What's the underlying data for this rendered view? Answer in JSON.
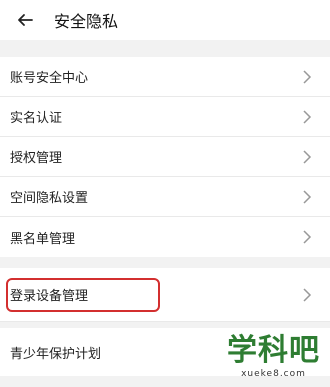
{
  "header": {
    "title": "安全隐私"
  },
  "groups": [
    {
      "items": [
        "账号安全中心",
        "实名认证",
        "授权管理",
        "空间隐私设置",
        "黑名单管理"
      ]
    },
    {
      "items": [
        "登录设备管理"
      ]
    },
    {
      "items": [
        "青少年保护计划"
      ]
    }
  ],
  "watermark": {
    "title": "学科吧",
    "domain": "xueke8.com"
  },
  "colors": {
    "highlight": "#d32f2f",
    "watermark": "#2e7d32"
  }
}
